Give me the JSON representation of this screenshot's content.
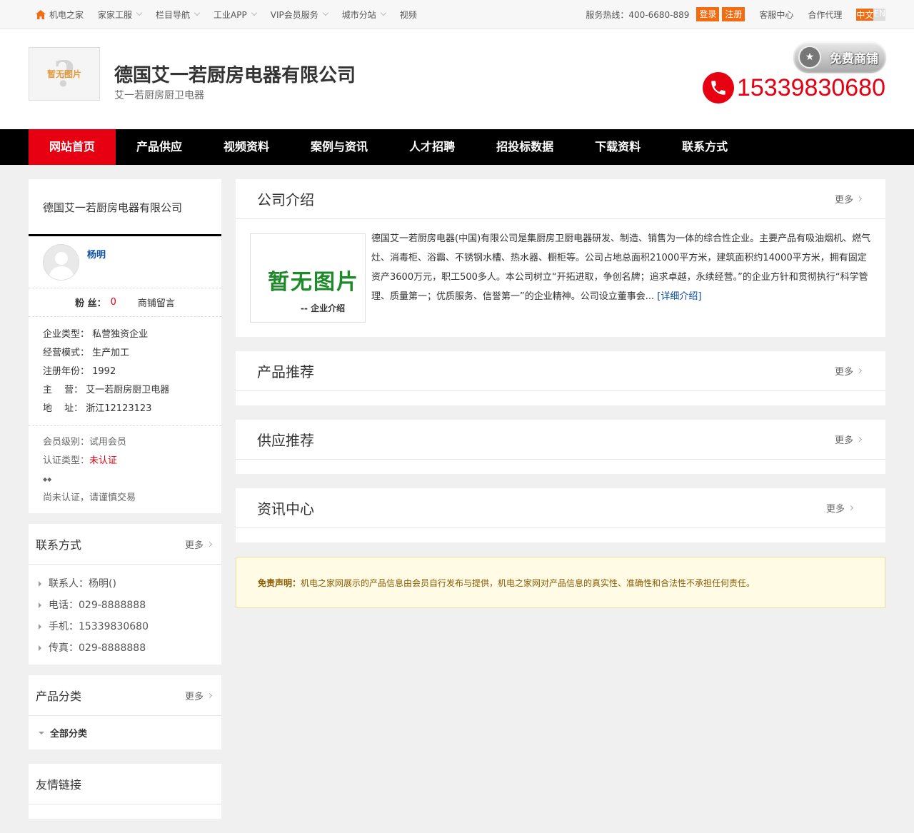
{
  "topbar": {
    "nav": [
      {
        "label": "机电之家",
        "icon": "home-icon",
        "caret": false
      },
      {
        "label": "家家工服",
        "caret": true
      },
      {
        "label": "栏目导航",
        "caret": true
      },
      {
        "label": "工业APP",
        "caret": true
      },
      {
        "label": "VIP会员服务",
        "caret": true
      },
      {
        "label": "城市分站",
        "caret": true
      },
      {
        "label": "视频",
        "caret": false
      }
    ],
    "hotline": "服务热线：400-6680-889",
    "login": "登录",
    "register": "注册",
    "service_center": "客服中心",
    "agency": "合作代理",
    "lang_zh": "中文",
    "lang_en": "EN"
  },
  "header": {
    "logo_text": "暂无图片",
    "company_name": "德国艾一若厨房电器有限公司",
    "company_sub": "艾一若厨房厨卫电器",
    "badge": "免费商铺",
    "phone": "15339830680"
  },
  "mainnav": [
    "网站首页",
    "产品供应",
    "视频资料",
    "案例与资讯",
    "人才招聘",
    "招投标数据",
    "下载资料",
    "联系方式"
  ],
  "sidebar": {
    "company": "德国艾一若厨房电器有限公司",
    "user_name": "杨明",
    "fans_label": "粉 丝：",
    "fans_value": "0",
    "message": "商铺留言",
    "info": [
      "企业类型：  私营独资企业",
      "经营模式：  生产加工",
      "注册年份：  1992",
      "主　  营：  艾一若厨房厨卫电器",
      "地　  址：  浙江12123123"
    ],
    "member_level_label": "会员级别：",
    "member_level": "试用会员",
    "cert_type_label": "认证类型：",
    "cert_type": "未认证",
    "dots": "◆◆",
    "warning": "尚未认证，请谨慎交易",
    "contact": {
      "title": "联系方式",
      "more": "更多",
      "rows": [
        "联系人：杨明()",
        "电话：029-8888888",
        "手机：15339830680",
        "传真：029-8888888"
      ]
    },
    "category": {
      "title": "产品分类",
      "more": "更多",
      "all": "全部分类"
    },
    "links": {
      "title": "友情链接"
    }
  },
  "main": {
    "intro": {
      "title": "公司介绍",
      "more": "更多",
      "img_big": "暂无图片",
      "img_small": "-- 企业介绍",
      "text": "德国艾一若厨房电器(中国)有限公司是集厨房卫厨电器研发、制造、销售为一体的综合性企业。主要产品有吸油烟机、燃气灶、消毒柜、浴霸、不锈钢水槽、热水器、橱柜等。公司占地总面积21000平方米，建筑面积约14000平方米，拥有固定资产3600万元，职工500多人。本公司树立“开拓进取，争创名牌；追求卓越，永续经营。”的企业方针和贯彻执行“科学管理、质量第一；优质服务、信誉第一”的企业精神。公司设立董事会...",
      "detail": "[详细介绍]"
    },
    "products": {
      "title": "产品推荐",
      "more": "更多"
    },
    "supply": {
      "title": "供应推荐",
      "more": "更多"
    },
    "news": {
      "title": "资讯中心",
      "more": "更多"
    },
    "disclaimer_label": "免责声明：",
    "disclaimer": "机电之家网展示的产品信息由会员自行发布与提供，机电之家网对产品信息的真实性、准确性和合法性不承担任何责任。"
  }
}
